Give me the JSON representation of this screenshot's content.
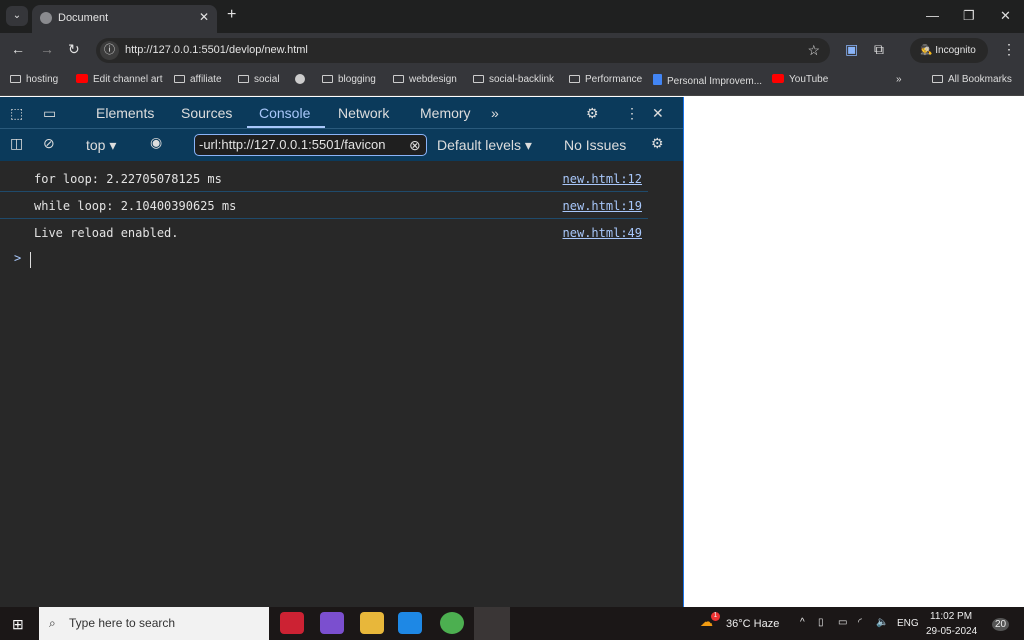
{
  "browser": {
    "tab_title": "Document",
    "url": "http://127.0.0.1:5501/devlop/new.html",
    "incognito_label": "Incognito",
    "bookmarks": [
      {
        "label": "hosting",
        "icon": "folder-icon"
      },
      {
        "label": "Edit channel art",
        "icon": "youtube-icon"
      },
      {
        "label": "affiliate",
        "icon": "folder-icon"
      },
      {
        "label": "social",
        "icon": "folder-icon"
      },
      {
        "label": "",
        "icon": "globe-icon"
      },
      {
        "label": "blogging",
        "icon": "folder-icon"
      },
      {
        "label": "webdesign",
        "icon": "folder-icon"
      },
      {
        "label": "social-backlink",
        "icon": "folder-icon"
      },
      {
        "label": "Performance",
        "icon": "site-icon"
      },
      {
        "label": "Personal Improvem...",
        "icon": "docs-icon"
      },
      {
        "label": "YouTube",
        "icon": "youtube-icon"
      }
    ],
    "all_bookmarks": "All Bookmarks"
  },
  "devtools": {
    "tabs": [
      "Elements",
      "Sources",
      "Console",
      "Network",
      "Memory"
    ],
    "active_tab": "Console",
    "context": "top",
    "filter_value": "-url:http://127.0.0.1:5501/favicon",
    "levels": "Default levels",
    "issues": "No Issues",
    "messages": [
      {
        "text": "for loop: 2.22705078125 ms",
        "source": "new.html:12"
      },
      {
        "text": "while loop: 2.10400390625 ms",
        "source": "new.html:19"
      },
      {
        "text": "Live reload enabled.",
        "source": "new.html:49"
      }
    ],
    "prompt": ">"
  },
  "taskbar": {
    "search_placeholder": "Type here to search",
    "weather": "36°C  Haze",
    "weather_badge": "1",
    "lang": "ENG",
    "time": "11:02 PM",
    "date": "29-05-2024",
    "notifications": "20"
  },
  "colors": {
    "devtools_toolbar": "#0b3a5b",
    "console_bg": "#282828",
    "link": "#a8c7fa"
  }
}
